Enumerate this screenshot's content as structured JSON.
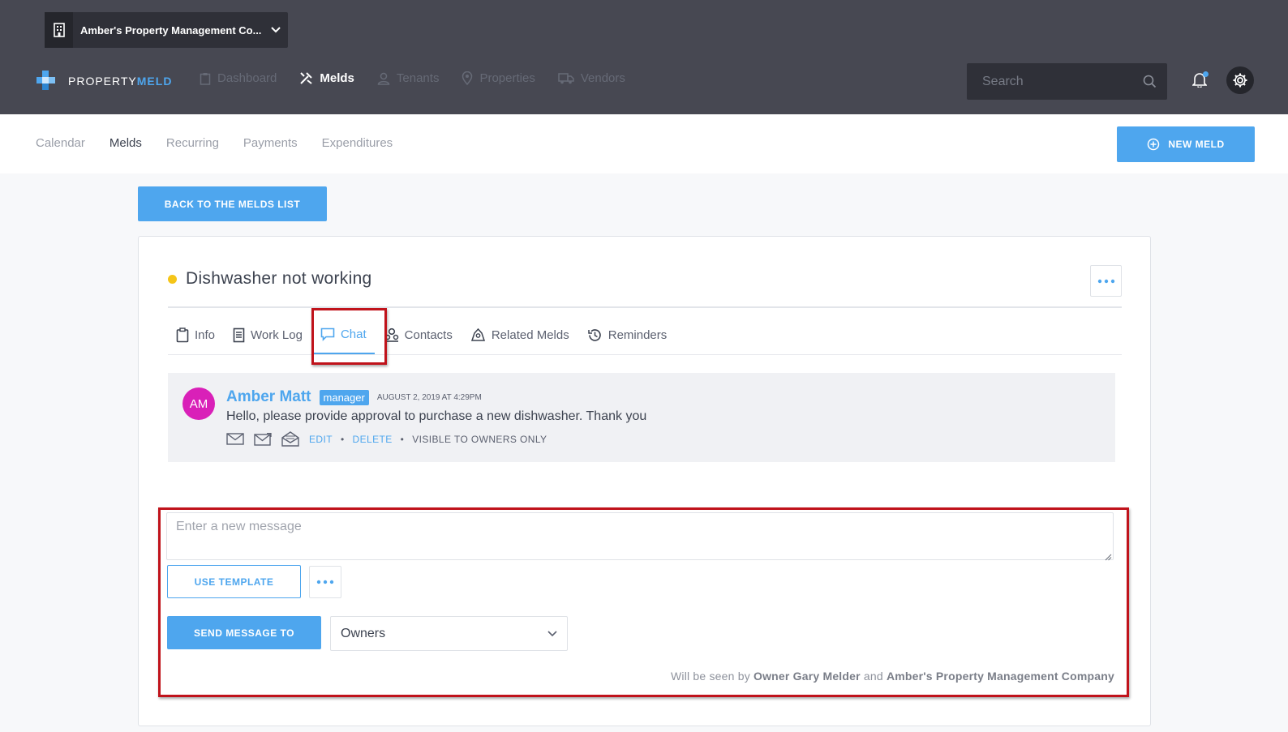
{
  "header": {
    "company_name": "Amber's Property Management Co...",
    "logo": {
      "part1": "PROPERTY",
      "part2": "MELD"
    },
    "nav": [
      {
        "label": "Dashboard",
        "icon": "clipboard-icon",
        "active": false
      },
      {
        "label": "Melds",
        "icon": "tools-icon",
        "active": true
      },
      {
        "label": "Tenants",
        "icon": "user-icon",
        "active": false
      },
      {
        "label": "Properties",
        "icon": "map-pin-icon",
        "active": false
      },
      {
        "label": "Vendors",
        "icon": "truck-icon",
        "active": false
      }
    ],
    "search_placeholder": "Search"
  },
  "subnav": {
    "items": [
      {
        "label": "Calendar",
        "active": false
      },
      {
        "label": "Melds",
        "active": true
      },
      {
        "label": "Recurring",
        "active": false
      },
      {
        "label": "Payments",
        "active": false
      },
      {
        "label": "Expenditures",
        "active": false
      }
    ],
    "new_meld_label": "NEW MELD"
  },
  "back_button_label": "BACK TO THE MELDS LIST",
  "meld": {
    "title": "Dishwasher not working",
    "status_color": "#f5c518",
    "tabs": [
      {
        "label": "Info",
        "icon": "clipboard-icon",
        "active": false
      },
      {
        "label": "Work Log",
        "icon": "document-icon",
        "active": false
      },
      {
        "label": "Chat",
        "icon": "chat-icon",
        "active": true
      },
      {
        "label": "Contacts",
        "icon": "contacts-icon",
        "active": false
      },
      {
        "label": "Related Melds",
        "icon": "related-icon",
        "active": false
      },
      {
        "label": "Reminders",
        "icon": "history-icon",
        "active": false
      }
    ]
  },
  "message": {
    "avatar_initials": "AM",
    "author": "Amber Matt",
    "role": "manager",
    "timestamp": "AUGUST 2, 2019 AT 4:29PM",
    "body": "Hello, please provide approval to purchase a new dishwasher.  Thank you",
    "edit_label": "EDIT",
    "delete_label": "DELETE",
    "visibility": "VISIBLE TO OWNERS ONLY"
  },
  "composer": {
    "placeholder": "Enter a new message",
    "use_template_label": "USE TEMPLATE",
    "send_label": "SEND MESSAGE TO",
    "recipient": "Owners",
    "seen_by_prefix": "Will be seen by",
    "seen_by_owner": "Owner Gary Melder",
    "seen_by_and": "and",
    "seen_by_company": "Amber's Property Management Company"
  },
  "colors": {
    "accent": "#4ea6ee",
    "header_bg": "#474852",
    "highlight": "#c0131b",
    "avatar": "#d920b8"
  }
}
